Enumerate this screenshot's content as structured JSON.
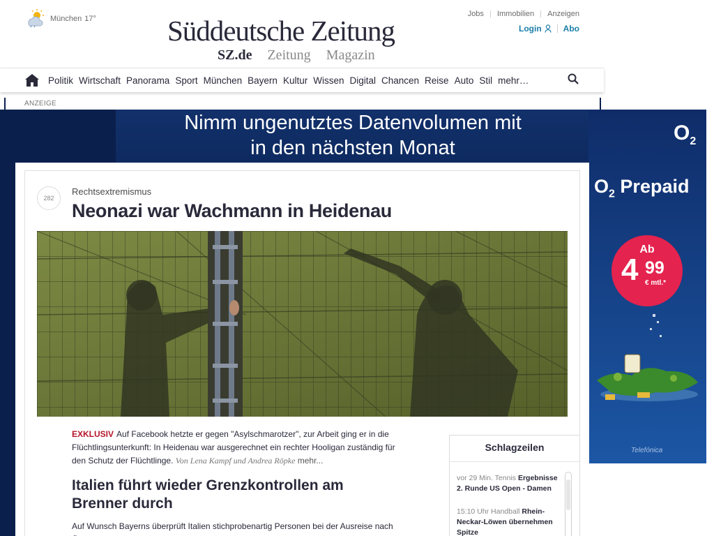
{
  "weather": {
    "city": "München",
    "temp": "17°",
    "icon": "partly-cloudy-rain-icon"
  },
  "brand": {
    "logo": "Süddeutsche Zeitung",
    "subnav": [
      "SZ.de",
      "Zeitung",
      "Magazin"
    ]
  },
  "toplinks": [
    "Jobs",
    "Immobilien",
    "Anzeigen"
  ],
  "account": {
    "login": "Login",
    "abo": "Abo"
  },
  "nav": {
    "items": [
      "Politik",
      "Wirtschaft",
      "Panorama",
      "Sport",
      "München",
      "Bayern",
      "Kultur",
      "Wissen",
      "Digital",
      "Chancen",
      "Reise",
      "Auto",
      "Stil",
      "mehr…"
    ]
  },
  "ad": {
    "label": "ANZEIGE",
    "headline_line1": "Nimm ungenutztes Datenvolumen mit",
    "headline_line2": "in den nächsten Monat",
    "logo_main": "O",
    "logo_sub": "2",
    "prepaid_main": "O",
    "prepaid_sub": "2",
    "prepaid_rest": " Prepaid",
    "price_prefix": "Ab",
    "price_int": "4",
    "price_dec": "99",
    "price_unit": "€ mtl.*",
    "sponsor": "Telefónica",
    "colors": {
      "navy": "#0b1f4d",
      "blue": "#1c57a5",
      "badge": "#e4234e"
    }
  },
  "article": {
    "comment_count": "282",
    "kicker": "Rechtsextremismus",
    "headline": "Neonazi war Wachmann in Heidenau",
    "label": "EXKLUSIV",
    "teaser": "Auf Facebook hetzte er gegen \"Asylschmarotzer\", zur Arbeit ging er in die Flüchtlingsunterkunft: In Heidenau war ausgerechnet ein rechter Hooligan zuständig für den Schutz der Flüchtlinge.",
    "authors": "Von Lena Kampf und Andrea Röpke",
    "more": "mehr..."
  },
  "article2": {
    "headline": "Italien führt wieder Grenzkontrollen am Brenner durch",
    "teaser": "Auf Wunsch Bayerns überprüft Italien stichprobenartig Personen bei der Ausreise nach Österreich."
  },
  "schlagzeilen": {
    "title": "Schlagzeilen",
    "items": [
      {
        "time": "vor 29 Min.",
        "section": "Tennis",
        "title": "Ergebnisse 2. Runde US Open - Damen"
      },
      {
        "time": "15:10 Uhr",
        "section": "Handball",
        "title": "Rhein-Neckar-Löwen übernehmen Spitze"
      }
    ]
  }
}
